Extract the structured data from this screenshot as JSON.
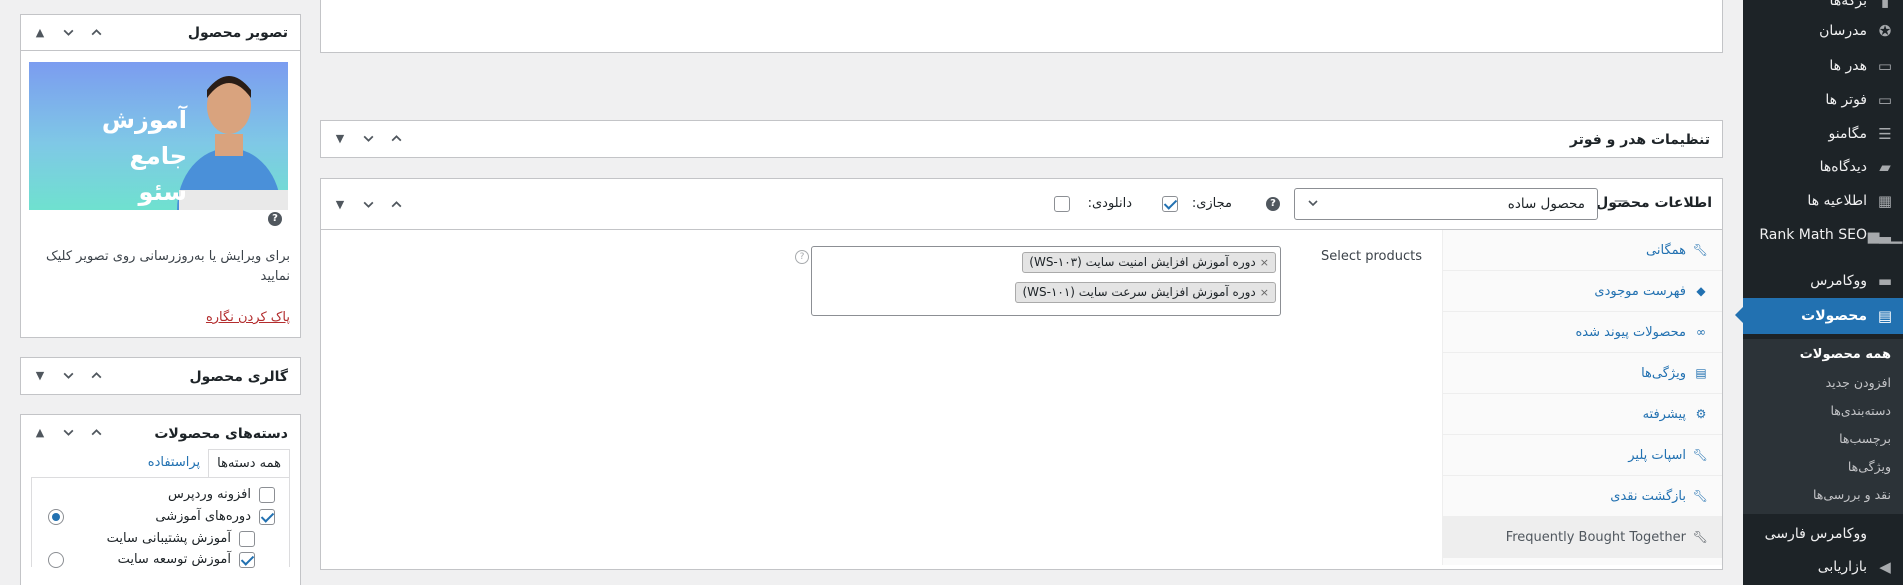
{
  "admin_menu": {
    "items": [
      {
        "label": "برگه‌ها",
        "icon": "page-icon"
      },
      {
        "label": "مدرسان",
        "icon": "award-icon"
      },
      {
        "label": "هدر ها",
        "icon": "header-icon"
      },
      {
        "label": "فوتر ها",
        "icon": "footer-icon"
      },
      {
        "label": "مگامنو",
        "icon": "menu-icon"
      },
      {
        "label": "دیدگاه‌ها",
        "icon": "comment-icon"
      },
      {
        "label": "اطلاعیه ها",
        "icon": "keyboard-icon"
      },
      {
        "label": "Rank Math SEO",
        "icon": "chart-icon"
      },
      {
        "label": "ووکامرس",
        "icon": "woo-icon"
      },
      {
        "label": "محصولات",
        "icon": "archive-icon"
      },
      {
        "label": "ووکامرس فارسی",
        "icon": ""
      },
      {
        "label": "بازاریابی",
        "icon": "megaphone-icon"
      }
    ],
    "submenu": [
      "همه محصولات",
      "افزودن جدید",
      "دسته‌بندی‌ها",
      "برچسب‌ها",
      "ویژگی‌ها",
      "نقد و بررسی‌ها"
    ]
  },
  "header_footer_box": {
    "title": "تنظیمات هدر و فوتر"
  },
  "product_data": {
    "title": "اطلاعات محصول",
    "dash": "—",
    "type_value": "محصول ساده",
    "virtual_label": "مجازی:",
    "downloadable_label": "دانلودی:",
    "help": "?",
    "tabs": [
      {
        "label": "همگانی",
        "icon": "wrench-icon"
      },
      {
        "label": "فهرست موجودی",
        "icon": "tag-icon"
      },
      {
        "label": "محصولات پیوند شده",
        "icon": "link-icon"
      },
      {
        "label": "ویژگی‌ها",
        "icon": "list-icon"
      },
      {
        "label": "پیشرفته",
        "icon": "gear-icon"
      },
      {
        "label": "اسپات پلیر",
        "icon": "wrench-icon"
      },
      {
        "label": "بازگشت نقدی",
        "icon": "wrench-icon"
      },
      {
        "label": "Frequently Bought Together",
        "icon": "wrench-icon"
      }
    ],
    "select_products_label": "Select products",
    "chips": [
      "دوره آموزش افزایش امنیت سایت (WS-۱۰۳)",
      "دوره آموزش افزایش سرعت سایت (WS-۱۰۱)"
    ],
    "chip_remove": "×"
  },
  "product_image": {
    "title": "تصویر محصول",
    "thumb_text_line1": "آموزش جامع",
    "thumb_text_line2": "سئو تکنیکال",
    "help": "?",
    "description": "برای ویرایش یا به‌روزرسانی روی تصویر کلیک نمایید",
    "remove_link": "پاک کردن نگاره"
  },
  "gallery": {
    "title": "گالری محصول"
  },
  "categories": {
    "title": "دسته‌های محصولات",
    "tab_all": "همه دسته‌ها",
    "tab_popular": "پراستفاده",
    "items": [
      {
        "label": "افزونه وردپرس",
        "checked": false
      },
      {
        "label": "دوره‌های آموزشی",
        "checked": true
      },
      {
        "label": "آموزش پشتیبانی سایت",
        "checked": false
      },
      {
        "label": "آموزش توسعه سایت",
        "checked": true
      }
    ]
  },
  "colors": {
    "accent": "#2271b1",
    "menu_bg": "#1d2327",
    "submenu_bg": "#2c3338"
  }
}
